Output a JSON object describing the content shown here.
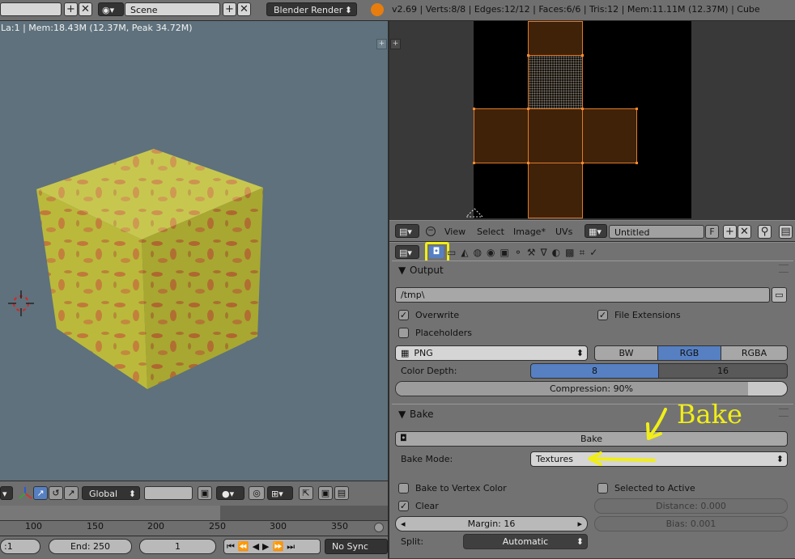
{
  "topbar": {
    "scene_label": "Scene",
    "engine_label": "Blender Render",
    "stats": "v2.69 | Verts:8/8 | Edges:12/12 | Faces:6/6 | Tris:12 | Mem:11.11M (12.37M) | Cube"
  },
  "viewport": {
    "info": "La:1 | Mem:18.43M (12.37M, Peak 34.72M)"
  },
  "uv_header": {
    "menus": [
      "View",
      "Select",
      "Image*",
      "UVs"
    ],
    "image_name": "Untitled",
    "fake_user": "F"
  },
  "output_panel": {
    "title": "Output",
    "path": "/tmp\\",
    "overwrite": "Overwrite",
    "file_extensions": "File Extensions",
    "placeholders": "Placeholders",
    "format": "PNG",
    "color_modes": [
      "BW",
      "RGB",
      "RGBA"
    ],
    "color_mode_active": "RGB",
    "color_depth_label": "Color Depth:",
    "color_depths": [
      "8",
      "16"
    ],
    "compression": "Compression: 90%",
    "compression_value": 0.9
  },
  "bake_panel": {
    "title": "Bake",
    "button": "Bake",
    "bake_mode_label": "Bake Mode:",
    "bake_mode": "Textures",
    "bake_to_vertex_color": "Bake to Vertex Color",
    "selected_to_active": "Selected to Active",
    "clear": "Clear",
    "distance": "Distance: 0.000",
    "margin": "Margin: 16",
    "bias": "Bias: 0.001",
    "split_label": "Split:",
    "split": "Automatic"
  },
  "annotation": {
    "text": "Bake",
    "color": "#f1ee17"
  },
  "viewport_header": {
    "orientation": "Global"
  },
  "timeline": {
    "ticks": [
      "100",
      "150",
      "200",
      "250",
      "300",
      "350"
    ],
    "start": ":1",
    "end": "End: 250",
    "current": "1",
    "sync": "No Sync"
  }
}
